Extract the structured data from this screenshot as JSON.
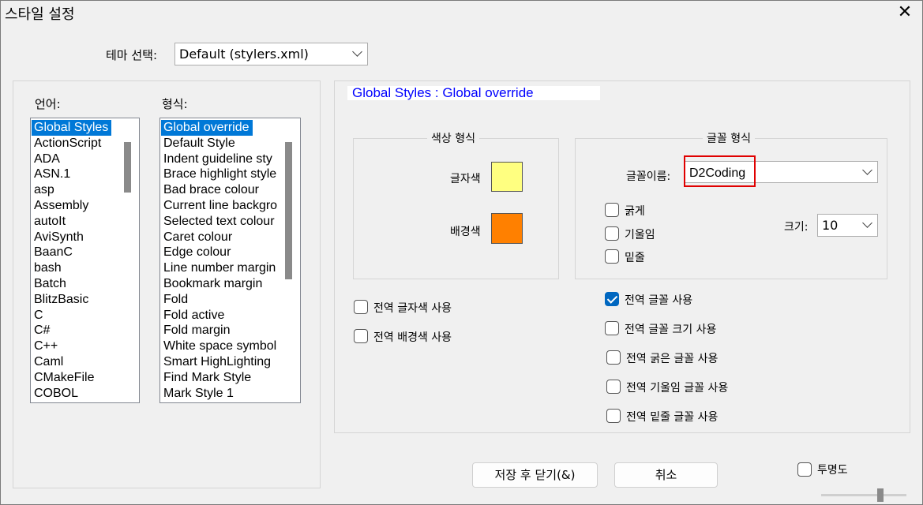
{
  "window": {
    "title": "스타일 설정",
    "close": "✕"
  },
  "theme": {
    "label": "테마 선택:",
    "value": "Default (stylers.xml)"
  },
  "language": {
    "label": "언어:",
    "items": [
      "Global Styles",
      "ActionScript",
      "ADA",
      "ASN.1",
      "asp",
      "Assembly",
      "autoIt",
      "AviSynth",
      "BaanC",
      "bash",
      "Batch",
      "BlitzBasic",
      "C",
      "C#",
      "C++",
      "Caml",
      "CMakeFile",
      "COBOL"
    ]
  },
  "style": {
    "label": "형식:",
    "items": [
      "Global override",
      "Default Style",
      "Indent guideline sty",
      "Brace highlight style",
      "Bad brace colour",
      "Current line backgro",
      "Selected text colour",
      "Caret colour",
      "Edge colour",
      "Line number margin",
      "Bookmark margin",
      "Fold",
      "Fold active",
      "Fold margin",
      "White space symbol",
      "Smart HighLighting",
      "Find Mark Style",
      "Mark Style 1"
    ]
  },
  "header": {
    "text": "Global Styles : Global override"
  },
  "color_group": {
    "title": "색상 형식",
    "fg_label": "글자색",
    "fg_color": "#ffff80",
    "bg_label": "배경색",
    "bg_color": "#ff8000"
  },
  "font_group": {
    "title": "글꼴 형식",
    "name_label": "글꼴이름:",
    "name_value": "D2Coding",
    "bold": "굵게",
    "italic": "기울임",
    "underline": "밑줄",
    "size_label": "크기:",
    "size_value": "10"
  },
  "global_options": {
    "fg": "전역 글자색 사용",
    "bg": "전역 배경색 사용",
    "font": "전역 글꼴 사용",
    "font_size": "전역 글꼴 크기 사용",
    "bold": "전역 굵은 글꼴 사용",
    "italic": "전역 기울임 글꼴 사용",
    "underline": "전역 밑줄 글꼴 사용"
  },
  "buttons": {
    "save_close": "저장 후 닫기(&)",
    "cancel": "취소"
  },
  "transparency": {
    "label": "투명도"
  },
  "colors": {
    "selection": "#0078d7",
    "header_text": "#0000ff",
    "highlight_border": "#e00000",
    "check_fill": "#0067c0"
  }
}
